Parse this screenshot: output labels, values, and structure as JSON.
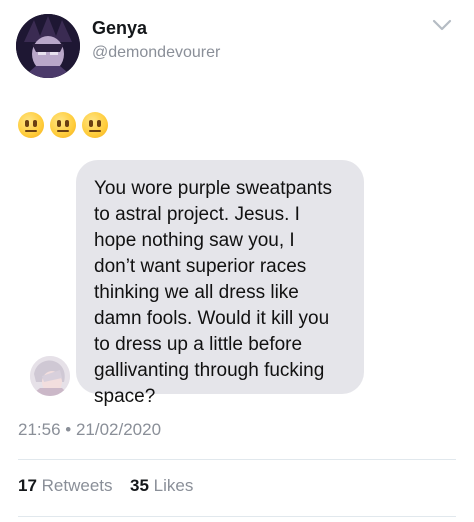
{
  "tweet": {
    "display_name": "Genya",
    "handle": "@demondevourer",
    "emoji_icon": "neutral-face-emoji",
    "emoji_count": 3,
    "message": "You wore purple sweatpants\nto astral project. Jesus. I\nhope nothing saw you, I\ndon’t want superior races\nthinking we all dress like\ndamn fools. Would it kill you\nto dress up a little before\ngallivanting through fucking\nspace?",
    "timestamp": "21:56 • 21/02/2020",
    "retweets_count": "17",
    "retweets_label": "Retweets",
    "likes_count": "35",
    "likes_label": "Likes"
  },
  "colors": {
    "bubble": "#e5e5ea",
    "secondary_text": "#8a8f98",
    "primary_text": "#14171a"
  }
}
